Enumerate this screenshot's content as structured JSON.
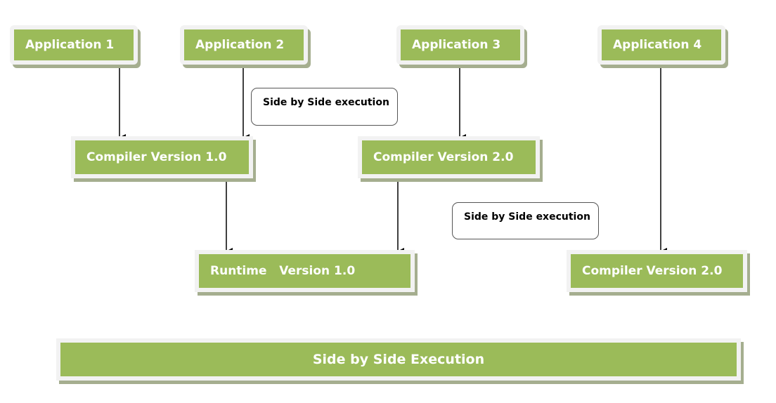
{
  "applications": [
    "Application 1",
    "Application 2",
    "Application 3",
    "Application 4"
  ],
  "compilers": [
    "Compiler Version 1.0",
    "Compiler Version 2.0",
    "Compiler Version 2.0"
  ],
  "runtime": "Runtime   Version 1.0",
  "callouts": [
    "Side by Side execution",
    "Side by Side execution"
  ],
  "footer": "Side by Side Execution",
  "colors": {
    "box_fill": "#9bbb59",
    "box_border": "#f2f2f2",
    "shadow": "#a5ae8f"
  }
}
